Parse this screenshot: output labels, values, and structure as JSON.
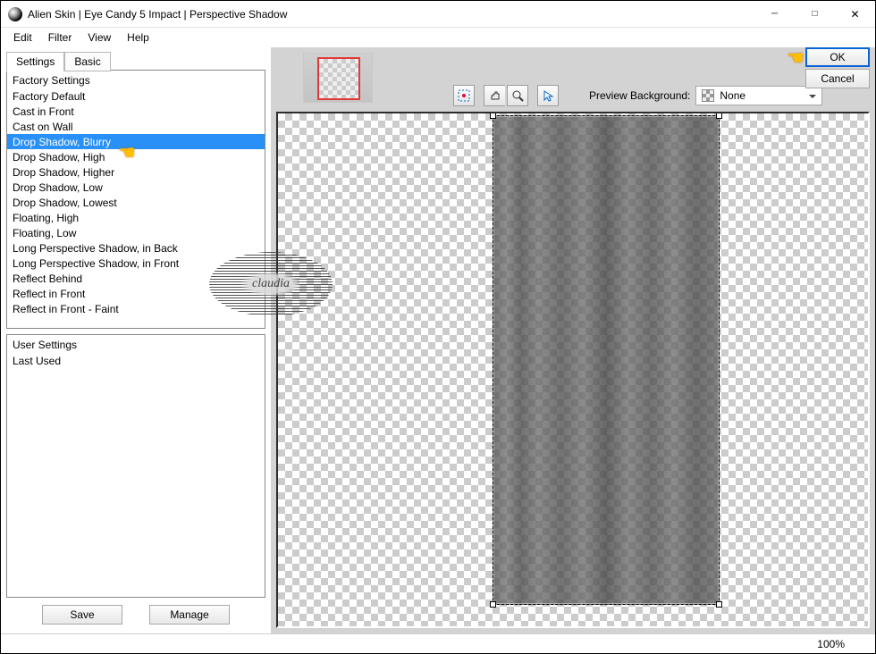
{
  "window": {
    "title": "Alien Skin | Eye Candy 5 Impact | Perspective Shadow"
  },
  "menu": {
    "edit": "Edit",
    "filter": "Filter",
    "view": "View",
    "help": "Help"
  },
  "tabs": {
    "settings": "Settings",
    "basic": "Basic"
  },
  "factory": {
    "header": "Factory Settings",
    "items": [
      "Factory Default",
      "Cast in Front",
      "Cast on Wall",
      "Drop Shadow, Blurry",
      "Drop Shadow, High",
      "Drop Shadow, Higher",
      "Drop Shadow, Low",
      "Drop Shadow, Lowest",
      "Floating, High",
      "Floating, Low",
      "Long Perspective Shadow, in Back",
      "Long Perspective Shadow, in Front",
      "Reflect Behind",
      "Reflect in Front",
      "Reflect in Front - Faint"
    ],
    "selected_index": 3
  },
  "user": {
    "header": "User Settings",
    "items": [
      "Last Used"
    ]
  },
  "buttons": {
    "save": "Save",
    "manage": "Manage",
    "ok": "OK",
    "cancel": "Cancel"
  },
  "preview": {
    "label": "Preview Background:",
    "selected": "None"
  },
  "status": {
    "zoom": "100%"
  },
  "stamp": "claudia"
}
